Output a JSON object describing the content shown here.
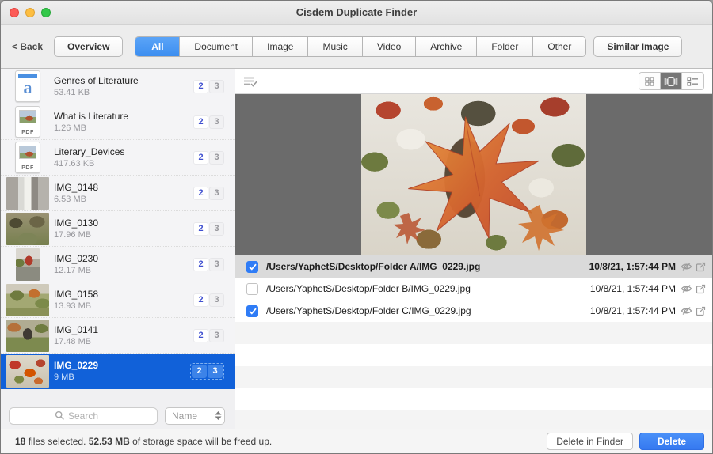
{
  "window": {
    "title": "Cisdem Duplicate Finder"
  },
  "toolbar": {
    "back_label": "< Back",
    "overview_label": "Overview",
    "tabs": [
      "All",
      "Document",
      "Image",
      "Music",
      "Video",
      "Archive",
      "Folder",
      "Other"
    ],
    "selected_tab": "All",
    "similar_image_label": "Similar Image"
  },
  "sidebar": {
    "items": [
      {
        "name": "Genres of Literature",
        "size": "53.41 KB",
        "count_selected": "2",
        "count_total": "3",
        "icon": "doc-text-icon",
        "selected": false
      },
      {
        "name": "What is Literature",
        "size": "1.26 MB",
        "count_selected": "2",
        "count_total": "3",
        "icon": "pdf-icon",
        "selected": false
      },
      {
        "name": "Literary_Devices",
        "size": "417.63 KB",
        "count_selected": "2",
        "count_total": "3",
        "icon": "pdf-icon",
        "selected": false
      },
      {
        "name": "IMG_0148",
        "size": "6.53 MB",
        "count_selected": "2",
        "count_total": "3",
        "icon": "photo-building-icon",
        "selected": false
      },
      {
        "name": "IMG_0130",
        "size": "17.96 MB",
        "count_selected": "2",
        "count_total": "3",
        "icon": "photo-trees-icon",
        "selected": false
      },
      {
        "name": "IMG_0230",
        "size": "12.17 MB",
        "count_selected": "2",
        "count_total": "3",
        "icon": "photo-road-icon",
        "selected": false
      },
      {
        "name": "IMG_0158",
        "size": "13.93 MB",
        "count_selected": "2",
        "count_total": "3",
        "icon": "photo-autumn-trees-icon",
        "selected": false
      },
      {
        "name": "IMG_0141",
        "size": "17.48 MB",
        "count_selected": "2",
        "count_total": "3",
        "icon": "photo-park-icon",
        "selected": false
      },
      {
        "name": "IMG_0229",
        "size": "9 MB",
        "count_selected": "2",
        "count_total": "3",
        "icon": "photo-leaves-icon",
        "selected": true
      }
    ]
  },
  "preview": {
    "image_description": "autumn maple leaves close-up"
  },
  "duplicates": {
    "rows": [
      {
        "path": "/Users/YaphetS/Desktop/Folder A/IMG_0229.jpg",
        "date": "10/8/21, 1:57:44 PM",
        "checked": true,
        "highlighted": true
      },
      {
        "path": "/Users/YaphetS/Desktop/Folder B/IMG_0229.jpg",
        "date": "10/8/21, 1:57:44 PM",
        "checked": false,
        "highlighted": false
      },
      {
        "path": "/Users/YaphetS/Desktop/Folder C/IMG_0229.jpg",
        "date": "10/8/21, 1:57:44 PM",
        "checked": true,
        "highlighted": false
      }
    ]
  },
  "search": {
    "placeholder": "Search",
    "sort_value": "Name"
  },
  "statusbar": {
    "message": [
      {
        "text": "18",
        "bold": true
      },
      {
        "text": " files selected. ",
        "bold": false
      },
      {
        "text": "52.53 MB",
        "bold": true
      },
      {
        "text": " of storage space will be freed up.",
        "bold": false
      }
    ],
    "delete_in_finder_label": "Delete in Finder",
    "delete_label": "Delete"
  },
  "colors": {
    "selection_blue": "#1161d9",
    "tab_selected_blue": "#3e8ef0",
    "delete_button_blue": "#3f82f7",
    "badge_count_blue": "#4050d0",
    "preview_background": "#6b6b6b",
    "highlight_row_gray": "#dadada"
  }
}
